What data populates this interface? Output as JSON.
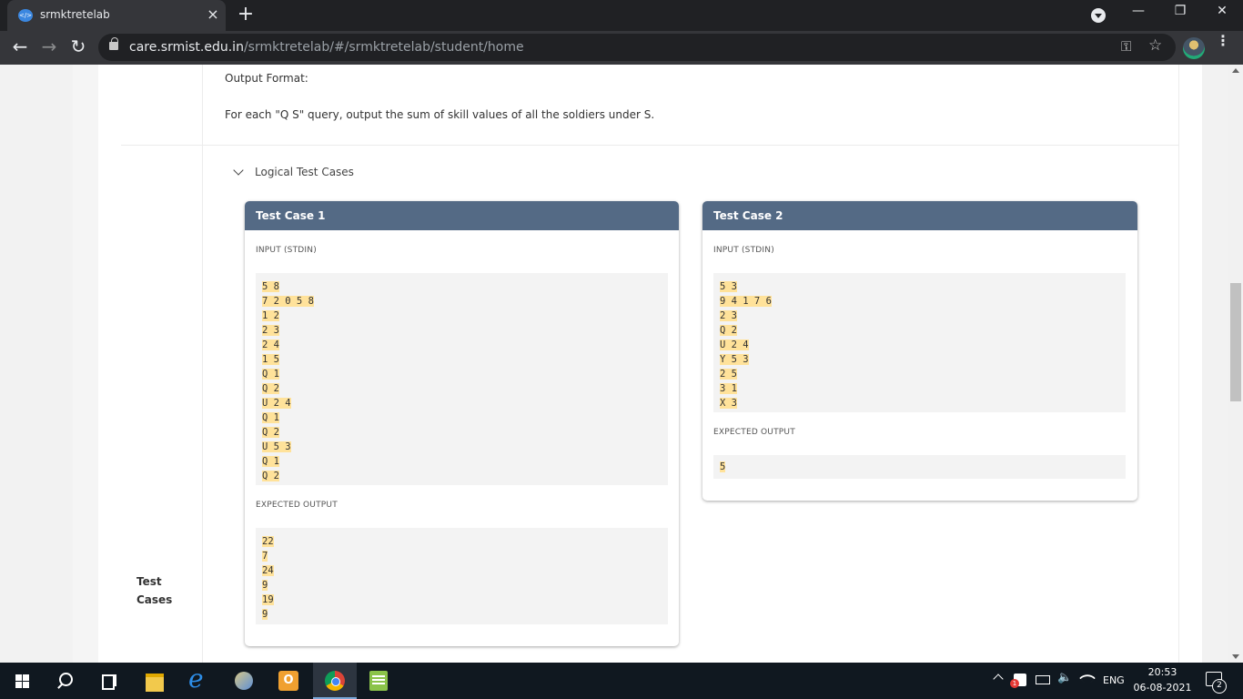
{
  "browser": {
    "tab_title": "srmktretelab",
    "tab_favicon": "</>",
    "close_tab_glyph": "×",
    "new_tab_glyph": "+",
    "url_host": "care.srmist.edu.in",
    "url_path": "/srmktretelab/#/srmktretelab/student/home",
    "minimize_glyph": "—",
    "restore_glyph": "❐",
    "close_window_glyph": "✕",
    "back_glyph": "←",
    "forward_glyph": "→",
    "reload_glyph": "↻",
    "key_glyph": "⚿",
    "star_glyph": "☆",
    "menu_glyph": "⋮"
  },
  "page": {
    "output_format_heading": "Output Format:",
    "output_format_text": "For each \"Q S\" query, output the sum of skill values of all the soldiers under S.",
    "logical_toggle_label": "Logical Test Cases",
    "side_label_line1": "Test",
    "side_label_line2": "Cases"
  },
  "test_cases": [
    {
      "title": "Test Case 1",
      "input_label": "INPUT (STDIN)",
      "input_lines": [
        "5 8",
        "7 2 0 5 8",
        "1 2",
        "2 3",
        "2 4",
        "1 5",
        "Q 1",
        "Q 2",
        "U 2 4",
        "Q 1",
        "Q 2",
        "U 5 3",
        "Q 1",
        "Q 2"
      ],
      "output_label": "EXPECTED OUTPUT",
      "output_lines": [
        "22",
        "7",
        "24",
        "9",
        "19",
        "9"
      ]
    },
    {
      "title": "Test Case 2",
      "input_label": "INPUT (STDIN)",
      "input_lines": [
        "5 3",
        "9 4 1 7 6",
        "2 3",
        "Q 2",
        "U 2 4",
        "Y 5 3",
        "2 5",
        "3 1",
        "X 3"
      ],
      "output_label": "EXPECTED OUTPUT",
      "output_lines": [
        "5"
      ]
    }
  ],
  "taskbar": {
    "language": "ENG",
    "time": "20:53",
    "date": "06-08-2021",
    "notification_count": "2"
  }
}
